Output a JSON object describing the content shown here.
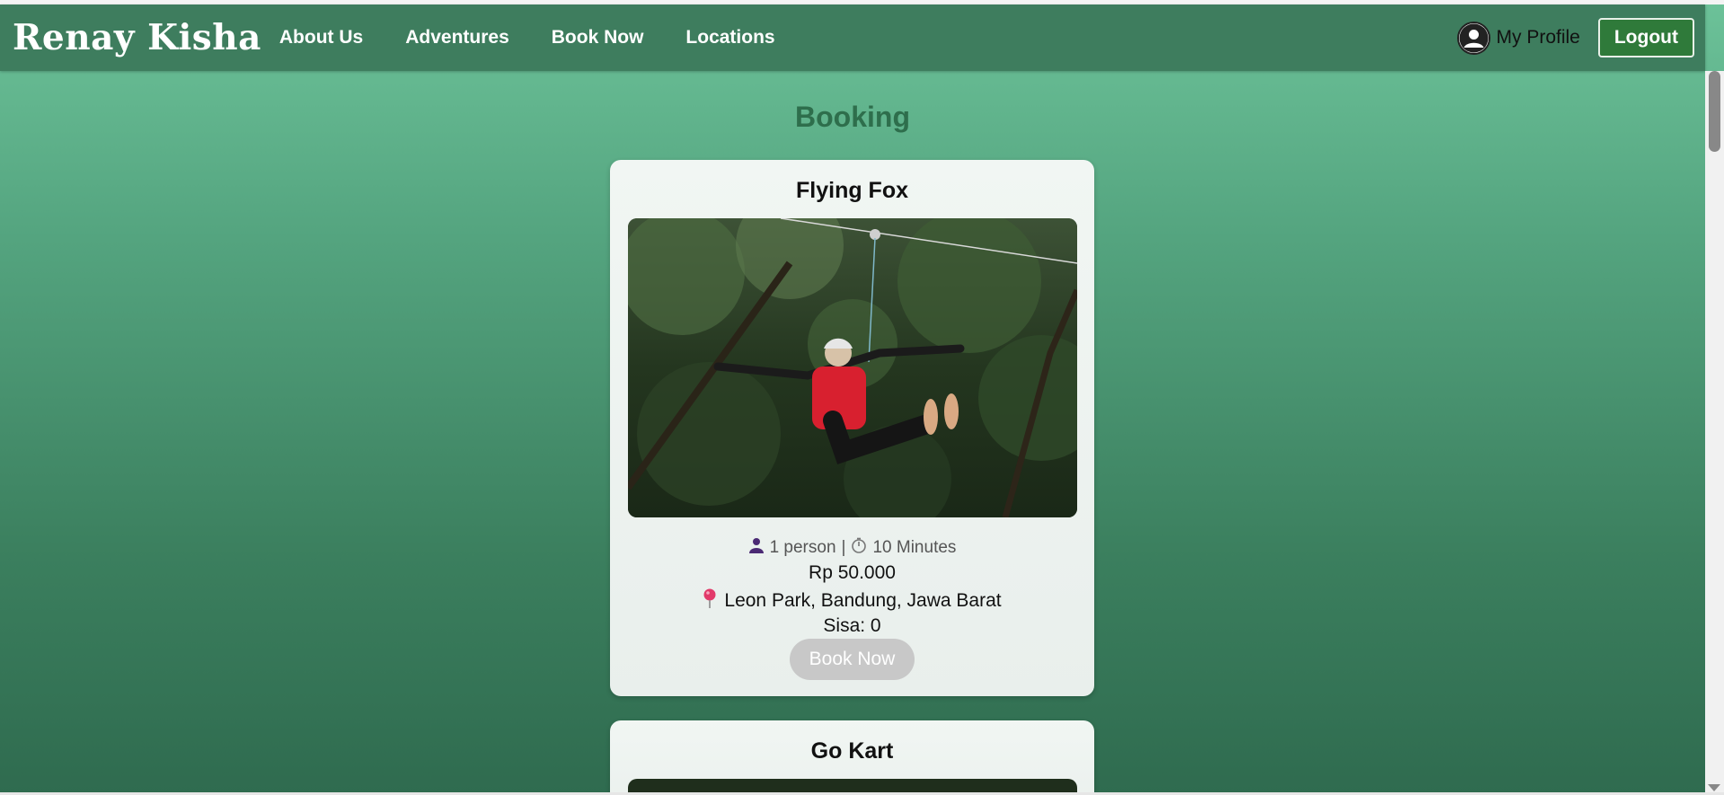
{
  "brand": "Renay Kisha",
  "nav": {
    "links": [
      "About Us",
      "Adventures",
      "Book Now",
      "Locations"
    ],
    "profile_label": "My Profile",
    "logout_label": "Logout"
  },
  "page": {
    "title": "Booking"
  },
  "cards": [
    {
      "title": "Flying Fox",
      "persons": "1 person",
      "separator": "|",
      "duration": "10 Minutes",
      "price": "Rp 50.000",
      "location": "Leon Park, Bandung, Jawa Barat",
      "stock": "Sisa: 0",
      "button": "Book Now"
    },
    {
      "title": "Go Kart"
    }
  ],
  "icons": {
    "person": "person-icon",
    "timer": "stopwatch-icon",
    "pin": "location-pin-icon",
    "profile": "user-avatar-icon"
  },
  "colors": {
    "navbar": "#3e7d5e",
    "title": "#2e6e4c",
    "logout": "#2f7a3a",
    "disabled_button": "#c8c8c8"
  }
}
